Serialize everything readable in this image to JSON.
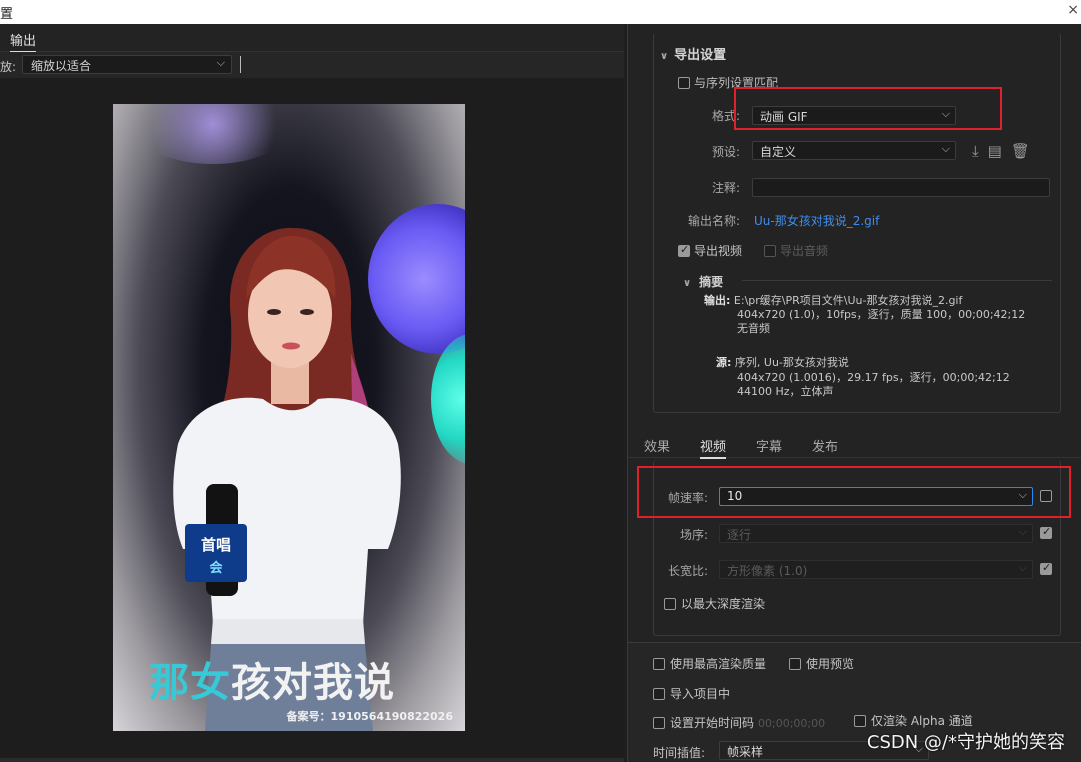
{
  "window": {
    "title": "置",
    "close": "×"
  },
  "left": {
    "tab_label": "输出",
    "scale_label": "放:",
    "scale_value": "缩放以适合",
    "caption_part1": "那女",
    "caption_part2": "孩对我说",
    "record_no": "备案号：1910564190822026"
  },
  "export": {
    "section_title": "导出设置",
    "match_sequence": "与序列设置匹配",
    "format_label": "格式:",
    "format_value": "动画 GIF",
    "preset_label": "预设:",
    "preset_value": "自定义",
    "comment_label": "注释:",
    "comment_value": "",
    "output_name_label": "输出名称:",
    "output_name_value": "Uu-那女孩对我说_2.gif",
    "export_video": "导出视频",
    "export_audio": "导出音频",
    "summary_title": "摘要",
    "summary_output_label": "输出:",
    "summary_output_lines": [
      "E:\\pr缓存\\PR项目文件\\Uu-那女孩对我说_2.gif",
      "404x720 (1.0)，10fps，逐行，质量 100，00;00;42;12",
      "无音频"
    ],
    "summary_source_label": "源:",
    "summary_source_lines": [
      "序列, Uu-那女孩对我说",
      "404x720 (1.0016)，29.17 fps，逐行，00;00;42;12",
      "44100 Hz，立体声"
    ]
  },
  "tabs": [
    "效果",
    "视频",
    "字幕",
    "发布"
  ],
  "video": {
    "framerate_label": "帧速率:",
    "framerate_value": "10",
    "field_label": "场序:",
    "field_value": "逐行",
    "aspect_label": "长宽比:",
    "aspect_value": "方形像素 (1.0)",
    "max_depth": "以最大深度渲染"
  },
  "bottom": {
    "max_quality": "使用最高渲染质量",
    "use_preview": "使用预览",
    "import_project": "导入项目中",
    "set_start_time": "设置开始时间码",
    "start_time_value": "00;00;00;00",
    "render_alpha": "仅渲染 Alpha 通道",
    "interp_label": "时间插值:",
    "interp_value": "帧采样"
  },
  "watermark": "CSDN @/*守护她的笑容",
  "colors": {
    "highlight_box": "#e0202a",
    "link_blue": "#3f8ef0",
    "caption_cyan": "#37c9d6"
  }
}
